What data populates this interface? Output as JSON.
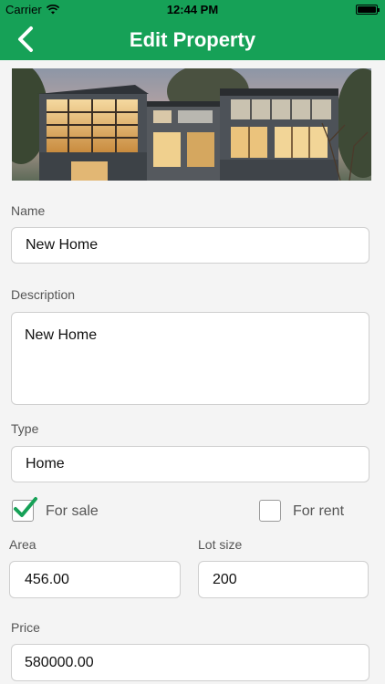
{
  "status": {
    "carrier": "Carrier",
    "time": "12:44 PM"
  },
  "nav": {
    "title": "Edit Property"
  },
  "form": {
    "name_label": "Name",
    "name_value": "New Home",
    "description_label": "Description",
    "description_value": "New Home",
    "type_label": "Type",
    "type_value": "Home",
    "for_sale_label": "For sale",
    "for_sale_checked": true,
    "for_rent_label": "For rent",
    "for_rent_checked": false,
    "area_label": "Area",
    "area_value": "456.00",
    "lot_size_label": "Lot size",
    "lot_size_value": "200",
    "price_label": "Price",
    "price_value": "580000.00"
  },
  "colors": {
    "accent": "#16a157"
  }
}
